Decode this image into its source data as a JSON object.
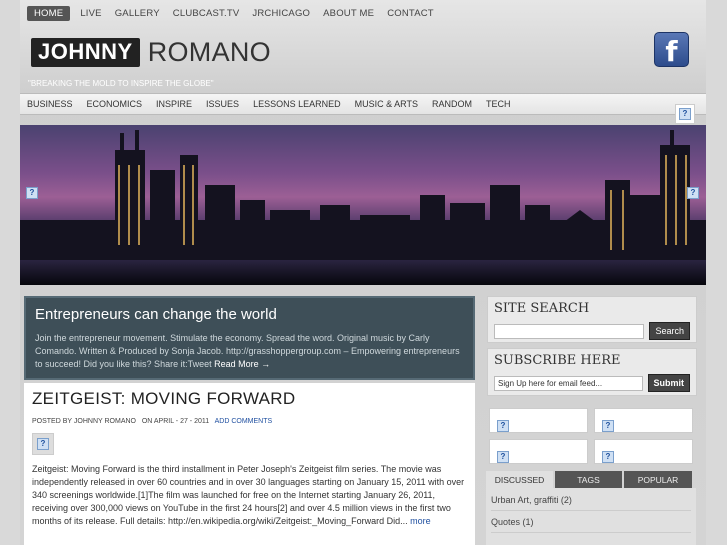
{
  "top_nav": [
    "Home",
    "Live",
    "Gallery",
    "Clubcast.TV",
    "JRChicago",
    "About Me",
    "Contact"
  ],
  "logo": {
    "first": "JOHNNY",
    "last": "ROMANO"
  },
  "tagline": "\"Breaking the mold to inspire the globe\"",
  "facebook_glyph": "f",
  "category_nav": [
    "Business",
    "Economics",
    "Inspire",
    "Issues",
    "Lessons Learned",
    "Music & Arts",
    "Random",
    "Tech"
  ],
  "featured": {
    "title": "Entrepreneurs can change the world",
    "text": "Join the entrepreneur movement. Stimulate the economy. Spread the word. Original music by Carly Comando. Written & Produced by Sonja Jacob. http://grasshoppergroup.com – Empowering entrepreneurs to succeed! Did you like this? Share it:Tweet ",
    "read_more": "Read More →"
  },
  "post": {
    "title": "ZEITGEIST: MOVING FORWARD",
    "posted_by": "Posted by Johnny Romano",
    "date": "on April - 27 - 2011",
    "comments": "Add Comments",
    "body": "Zeitgeist: Moving Forward is the third installment in Peter Joseph's Zeitgeist film series. The movie was independently released in over 60 countries and in over 30 languages starting on January 15, 2011 with over 340 screenings worldwide.[1]The film was launched for free on the Internet starting January 26, 2011, receiving over 300,000 views on YouTube in the first 24 hours[2] and over 4.5 million views in the first two months of its release. Full details: http://en.wikipedia.org/wiki/Zeitgeist:_Moving_Forward Did... ",
    "more": "more"
  },
  "site_search": {
    "title": "Site Search",
    "placeholder": "",
    "button": "Search"
  },
  "subscribe": {
    "title": "Subscribe Here",
    "value": "Sign Up here for email feed...",
    "button": "Submit"
  },
  "broken_image_glyph": "?",
  "tabs": [
    "Discussed",
    "Tags",
    "Popular"
  ],
  "discussed": [
    {
      "label": "Urban Art, graffiti",
      "count": "(2)"
    },
    {
      "label": "Quotes",
      "count": "(1)"
    }
  ]
}
